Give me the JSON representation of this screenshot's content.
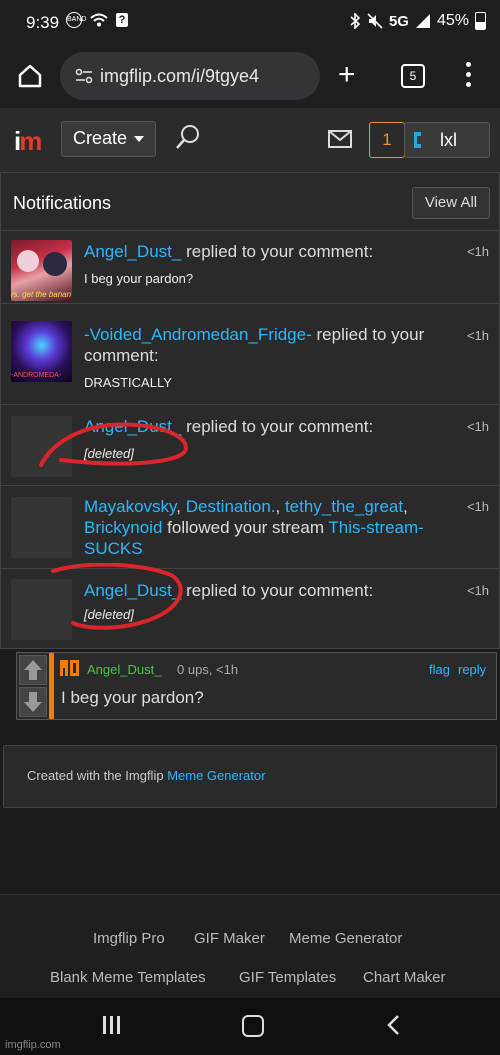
{
  "status_bar": {
    "time": "9:39",
    "badge": "BAND",
    "network": "5G",
    "battery": "45%"
  },
  "browser": {
    "url": "imgflip.com/i/9tgye4",
    "tab_count": "5"
  },
  "header": {
    "create_label": "Create",
    "notif_count": "1",
    "username": "lxl"
  },
  "notifications": {
    "title": "Notifications",
    "view_all": "View All",
    "items": [
      {
        "actors": [
          "Angel_Dust_"
        ],
        "action": "replied to your comment:",
        "excerpt": "I beg your pardon?",
        "time": "<1h",
        "thumb_caption": "rs. get the banan"
      },
      {
        "actors": [
          "-Voided_Andromedan_Fridge-"
        ],
        "action": "replied to your comment:",
        "excerpt": "DRASTICALLY",
        "time": "<1h",
        "thumb_caption": "-ANDROMEDA-"
      },
      {
        "actors": [
          "Angel_Dust_"
        ],
        "action": "replied to your comment:",
        "excerpt": "[deleted]",
        "time": "<1h"
      },
      {
        "actors": [
          "Mayakovsky",
          "Destination.",
          "tethy_the_great",
          "Brickynoid"
        ],
        "action": "followed your stream",
        "stream": "This-stream-SUCKS",
        "time": "<1h"
      },
      {
        "actors": [
          "Angel_Dust_"
        ],
        "action": "replied to your comment:",
        "excerpt": "[deleted]",
        "time": "<1h"
      }
    ]
  },
  "comment": {
    "user": "Angel_Dust_",
    "meta": "0 ups, <1h",
    "flag": "flag",
    "reply": "reply",
    "text": "I beg your pardon?"
  },
  "created": {
    "prefix": "Created with the Imgflip ",
    "link": "Meme Generator"
  },
  "footer": {
    "links": [
      "Imgflip Pro",
      "GIF Maker",
      "Meme Generator",
      "Blank Meme Templates",
      "GIF Templates",
      "Chart Maker"
    ]
  },
  "watermark": "imgflip.com",
  "colors": {
    "link": "#2db7ff",
    "annotation": "#d8262a",
    "accent": "#f57c00",
    "username_green": "#4ec34e"
  }
}
